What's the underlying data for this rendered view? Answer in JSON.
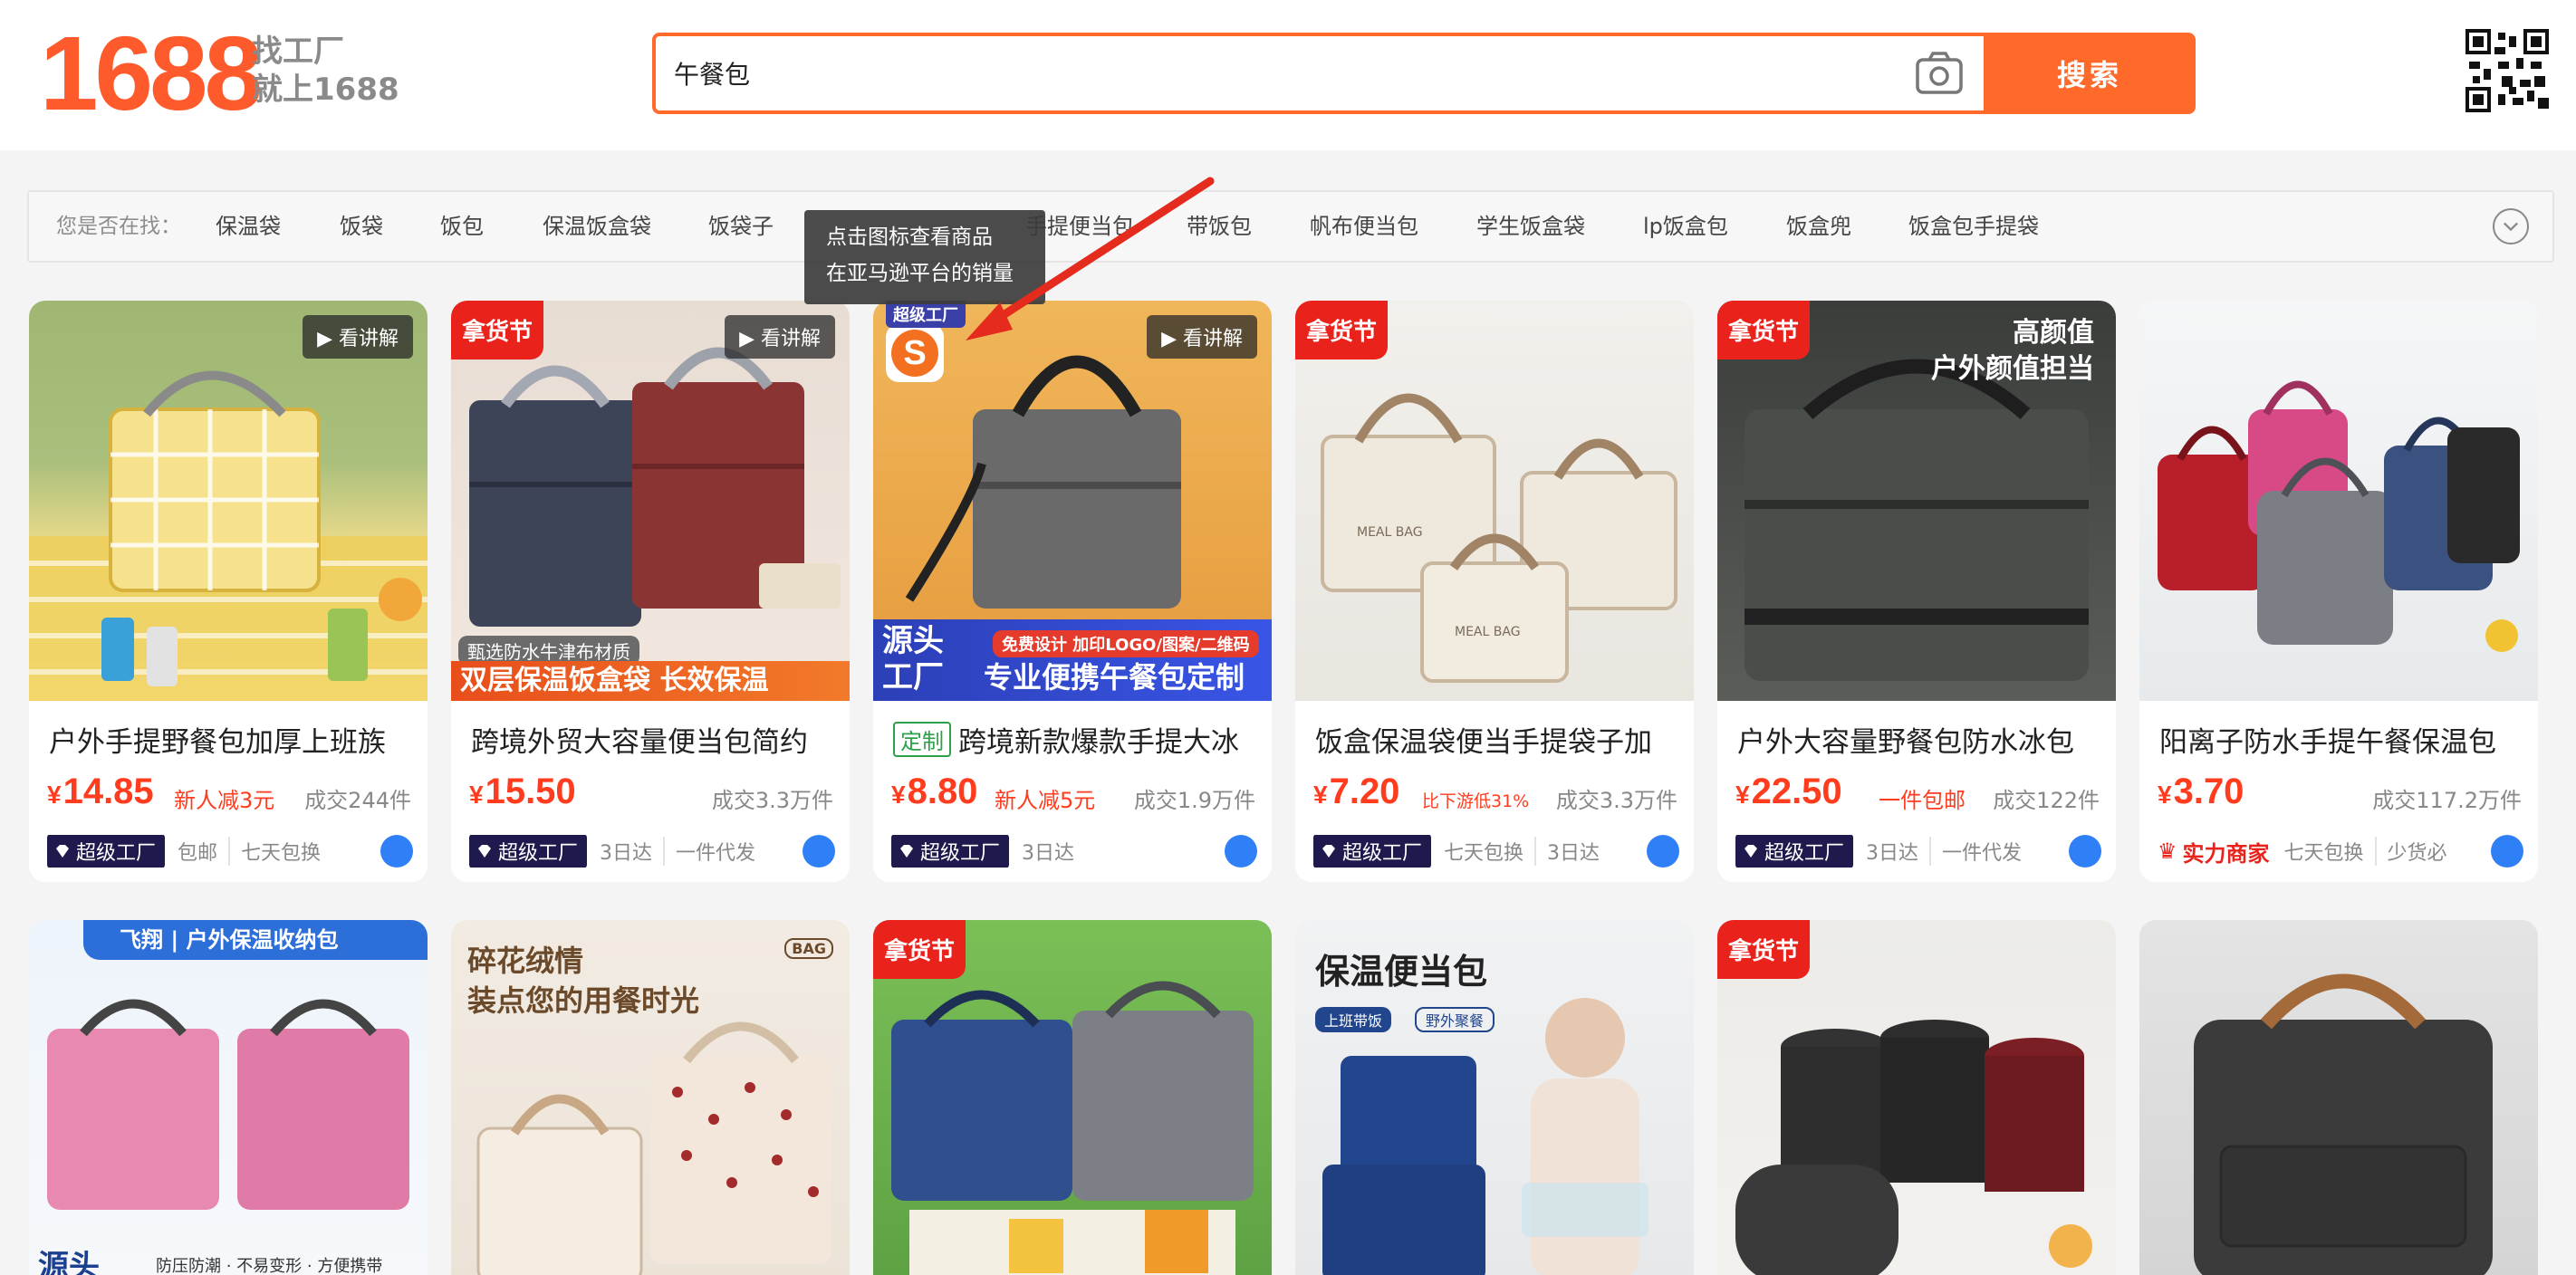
{
  "header": {
    "logo_number": "1688",
    "logo_slogan_line1": "找工厂",
    "logo_slogan_line2": "就上1688",
    "search_value": "午餐包",
    "search_button": "搜索",
    "camera_icon": "camera-icon",
    "qr_icon": "qr-code-icon"
  },
  "suggestions": {
    "label": "您是否在找：",
    "items": [
      "保温袋",
      "饭袋",
      "饭包",
      "保温饭盒袋",
      "饭袋子",
      "手提便当包",
      "带饭包",
      "帆布便当包",
      "学生饭盒袋",
      "lp饭盒包",
      "饭盒兜",
      "饭盒包手提袋"
    ]
  },
  "tooltip": {
    "line1": "点击图标查看商品",
    "line2": "在亚马逊平台的销量"
  },
  "products": [
    {
      "title": "户外手提野餐包加厚上班族",
      "price": "14.85",
      "promo": "新人减3元",
      "sales": "成交244件",
      "badge": "超级工厂",
      "chips": [
        "包邮",
        "七天包换"
      ],
      "live": "看讲解"
    },
    {
      "title": "跨境外贸大容量便当包简约",
      "price": "15.50",
      "promo": "",
      "sales": "成交3.3万件",
      "badge": "超级工厂",
      "chips": [
        "3日达",
        "一件代发"
      ],
      "tag": "拿货节",
      "live": "看讲解",
      "overlay_small": "甄选防水牛津布材质",
      "overlay_big": "双层保温饭盒袋 长效保温"
    },
    {
      "title": "跨境新款爆款手提大冰",
      "title_tag": "定制",
      "price": "8.80",
      "promo": "新人减5元",
      "sales": "成交1.9万件",
      "badge": "超级工厂",
      "chips": [
        "3日达"
      ],
      "live": "看讲解",
      "overlay_left1": "源头",
      "overlay_left2": "工厂",
      "overlay_small": "免费设计 加印LOGO/图案/二维码",
      "overlay_big": "专业便携午餐包定制",
      "factory_badge": "超级工厂"
    },
    {
      "title": "饭盒保温袋便当手提袋子加",
      "price": "7.20",
      "promo": "比下游低31%",
      "sales": "成交3.3万件",
      "badge": "超级工厂",
      "chips": [
        "七天包换",
        "3日达"
      ],
      "tag": "拿货节"
    },
    {
      "title": "户外大容量野餐包防水冰包",
      "price": "22.50",
      "promo": "一件包邮",
      "sales": "成交122件",
      "badge": "超级工厂",
      "chips": [
        "3日达",
        "一件代发"
      ],
      "tag": "拿货节",
      "overlay_line1": "高颜值",
      "overlay_line2": "户外颜值担当"
    },
    {
      "title": "阳离子防水手提午餐保温包",
      "price": "3.70",
      "promo": "",
      "sales": "成交117.2万件",
      "badge": "实力商家",
      "chips": [
        "七天包换",
        "少货必"
      ]
    }
  ],
  "row2": [
    {
      "overlay_top": "飞翔 | 户外保温收纳包",
      "overlay_bottom": "源头",
      "overlay_bottom2": "防压防潮 · 不易变形 · 方便携带"
    },
    {
      "overlay_line1": "碎花绒情",
      "overlay_line2": "装点您的用餐时光",
      "corner": "BAG"
    },
    {
      "tag": "拿货节"
    },
    {
      "overlay_title": "保温便当包",
      "pill1": "上班带饭",
      "pill2": "野外聚餐"
    },
    {
      "tag": "拿货节"
    },
    {}
  ],
  "colors": {
    "brand": "#ff5a2b",
    "search_accent": "#ff6a2b",
    "price": "#ff3c1e",
    "tag_red": "#e9231c",
    "factory_badge": "#1f1a4e"
  }
}
